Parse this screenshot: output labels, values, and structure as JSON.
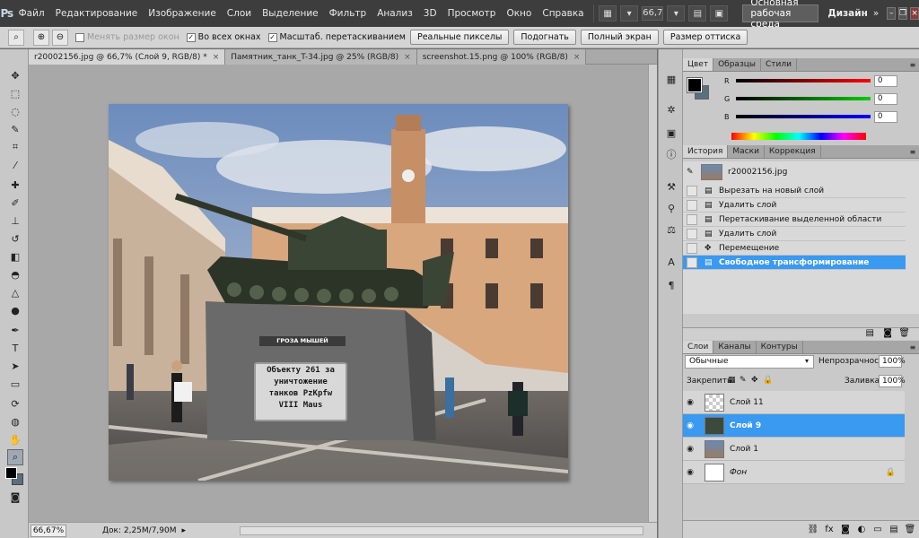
{
  "app": {
    "logo": "Ps"
  },
  "menu": [
    "Файл",
    "Редактирование",
    "Изображение",
    "Слои",
    "Выделение",
    "Фильтр",
    "Анализ",
    "3D",
    "Просмотр",
    "Окно",
    "Справка"
  ],
  "topbar": {
    "zoom": "66,7",
    "workspace": "Основная рабочая среда",
    "design": "Дизайн",
    "more": "»"
  },
  "options": {
    "resize_windows": "Менять размер окон",
    "all_windows": "Во всех окнах",
    "scrubby_zoom": "Масштаб. перетаскиванием",
    "actual_pixels": "Реальные пикселы",
    "fit_screen": "Подогнать",
    "fill_screen": "Полный экран",
    "print_size": "Размер оттиска"
  },
  "tabs": [
    {
      "title": "r20002156.jpg @ 66,7% (Слой 9, RGB/8) *",
      "close": "×"
    },
    {
      "title": "Памятник_танк_T-34.jpg @ 25% (RGB/8)",
      "close": "×"
    },
    {
      "title": "screenshot.15.png @ 100% (RGB/8)",
      "close": "×"
    }
  ],
  "photo": {
    "plaque_title": "ГРОЗА МЫШЕЙ",
    "plaque_lines": [
      "Объекту 261 за",
      "уничтожение",
      "танков PzKpfw",
      "VIII Maus"
    ]
  },
  "status": {
    "zoom": "66,67%",
    "doc": "Док: 2,25M/7,90M"
  },
  "color_panel": {
    "tabs": [
      "Цвет",
      "Образцы",
      "Стили"
    ],
    "colors": {
      "foreground": "#000000",
      "background": "#5a6f80"
    },
    "sliders": [
      {
        "label": "R",
        "value": "0"
      },
      {
        "label": "G",
        "value": "0"
      },
      {
        "label": "B",
        "value": "0"
      }
    ]
  },
  "history_panel": {
    "tabs": [
      "История",
      "Маски",
      "Коррекция"
    ],
    "snapshot": "r20002156.jpg",
    "items": [
      "Вырезать на новый слой",
      "Удалить слой",
      "Перетаскивание выделенной области",
      "Удалить слой",
      "Перемещение",
      "Свободное трансформирование"
    ]
  },
  "layers_panel": {
    "tabs": [
      "Слои",
      "Каналы",
      "Контуры"
    ],
    "blend_mode": "Обычные",
    "opacity_label": "Непрозрачность:",
    "opacity": "100%",
    "lock_label": "Закрепить:",
    "fill_label": "Заливка:",
    "fill": "100%",
    "layers": [
      {
        "name": "Слой 11"
      },
      {
        "name": "Слой 9"
      },
      {
        "name": "Слой 1"
      },
      {
        "name": "Фон"
      }
    ]
  },
  "accent": "#3a99f0"
}
